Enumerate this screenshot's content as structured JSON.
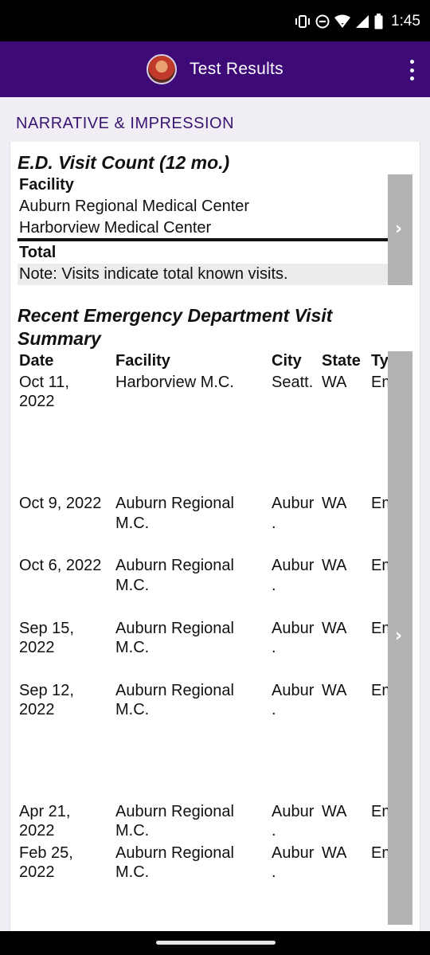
{
  "status_bar": {
    "time": "1:45"
  },
  "app_bar": {
    "title": "Test Results"
  },
  "section": {
    "header": "NARRATIVE & IMPRESSION"
  },
  "ed_count": {
    "title": "E.D. Visit Count (12 mo.)",
    "facility_header": "Facility",
    "facilities": [
      "Auburn Regional Medical Center",
      "Harborview Medical Center"
    ],
    "total_label": "Total",
    "note": "Note: Visits indicate total known visits."
  },
  "recent": {
    "title_line1": "Recent Emergency Department Visit",
    "title_line2": "Summary",
    "headers": {
      "date": "Date",
      "facility": "Facility",
      "city": "City",
      "state": "State",
      "type": "Type"
    },
    "rows": [
      {
        "date1": "Oct 11,",
        "date2": "2022",
        "facility1": "Harborview M.C.",
        "facility2": "",
        "city1": "Seatt.",
        "city2": "",
        "state": "WA",
        "type": "Emerg"
      },
      {
        "date1": "Oct 9, 2022",
        "date2": "",
        "facility1": "Auburn Regional",
        "facility2": "M.C.",
        "city1": "Aubur",
        "city2": ".",
        "state": "WA",
        "type": "Emerg"
      },
      {
        "date1": "Oct 6, 2022",
        "date2": "",
        "facility1": "Auburn Regional",
        "facility2": "M.C.",
        "city1": "Aubur",
        "city2": ".",
        "state": "WA",
        "type": "Emerg"
      },
      {
        "date1": "Sep 15,",
        "date2": "2022",
        "facility1": "Auburn Regional",
        "facility2": "M.C.",
        "city1": "Aubur",
        "city2": ".",
        "state": "WA",
        "type": "Emerg"
      },
      {
        "date1": "Sep 12,",
        "date2": "2022",
        "facility1": "Auburn Regional",
        "facility2": "M.C.",
        "city1": "Aubur",
        "city2": ".",
        "state": "WA",
        "type": "Emerg"
      },
      {
        "date1": "Apr 21,",
        "date2": "2022",
        "facility1": "Auburn Regional",
        "facility2": "M.C.",
        "city1": "Aubur",
        "city2": ".",
        "state": "WA",
        "type": "Emerg"
      },
      {
        "date1": "Feb 25,",
        "date2": "2022",
        "facility1": "Auburn Regional",
        "facility2": "M.C.",
        "city1": "Aubur",
        "city2": ".",
        "state": "WA",
        "type": "Emerg"
      }
    ]
  },
  "icons": {
    "vibrate": "vibrate-icon",
    "dnd": "do-not-disturb-icon",
    "wifi": "wifi-icon",
    "signal": "cell-signal-icon",
    "battery": "battery-icon",
    "overflow": "more-vert-icon",
    "chevron": "chevron-right-icon"
  },
  "colors": {
    "app_bar": "#3d0a78",
    "section_header": "#3a1472",
    "strip": "#b3b3b3"
  }
}
